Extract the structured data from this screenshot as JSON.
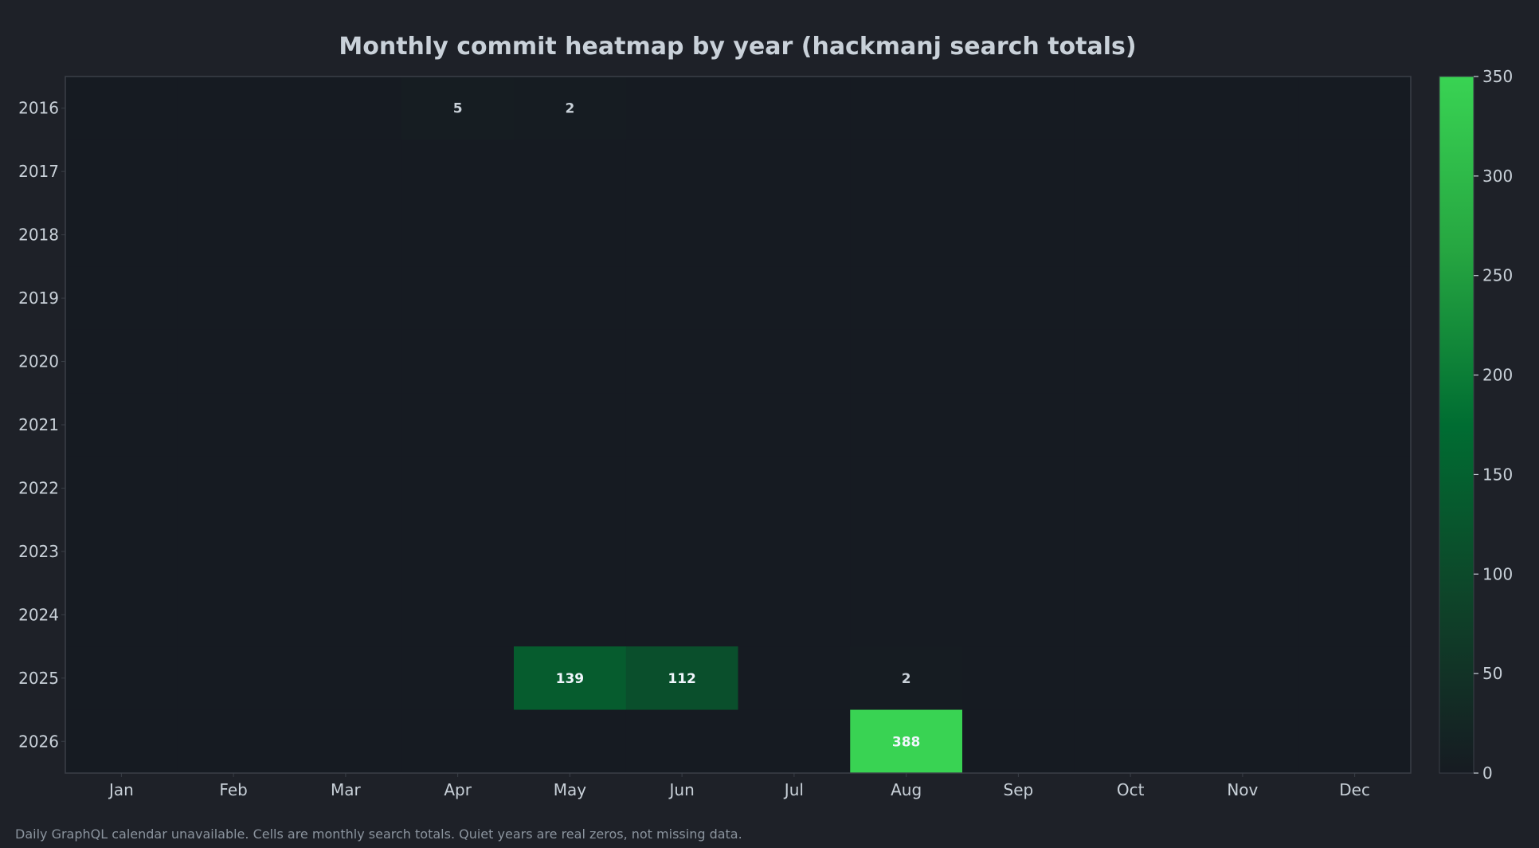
{
  "chart_data": {
    "type": "heatmap",
    "title": "Monthly commit heatmap by year (hackmanj search totals)",
    "x_categories": [
      "Jan",
      "Feb",
      "Mar",
      "Apr",
      "May",
      "Jun",
      "Jul",
      "Aug",
      "Sep",
      "Oct",
      "Nov",
      "Dec"
    ],
    "y_categories": [
      "2016",
      "2017",
      "2018",
      "2019",
      "2020",
      "2021",
      "2022",
      "2023",
      "2024",
      "2025",
      "2026"
    ],
    "values": [
      [
        0,
        0,
        0,
        5,
        2,
        0,
        0,
        0,
        0,
        0,
        0,
        0
      ],
      [
        0,
        0,
        0,
        0,
        0,
        0,
        0,
        0,
        0,
        0,
        0,
        0
      ],
      [
        0,
        0,
        0,
        0,
        0,
        0,
        0,
        0,
        0,
        0,
        0,
        0
      ],
      [
        0,
        0,
        0,
        0,
        0,
        0,
        0,
        0,
        0,
        0,
        0,
        0
      ],
      [
        0,
        0,
        0,
        0,
        0,
        0,
        0,
        0,
        0,
        0,
        0,
        0
      ],
      [
        0,
        0,
        0,
        0,
        0,
        0,
        0,
        0,
        0,
        0,
        0,
        0
      ],
      [
        0,
        0,
        0,
        0,
        0,
        0,
        0,
        0,
        0,
        0,
        0,
        0
      ],
      [
        0,
        0,
        0,
        0,
        0,
        0,
        0,
        0,
        0,
        0,
        0,
        0
      ],
      [
        0,
        0,
        0,
        0,
        0,
        0,
        0,
        0,
        0,
        0,
        0,
        0
      ],
      [
        0,
        0,
        0,
        0,
        139,
        112,
        0,
        2,
        0,
        0,
        0,
        0
      ],
      [
        0,
        0,
        0,
        0,
        0,
        0,
        0,
        388,
        0,
        0,
        0,
        0
      ]
    ],
    "colorbar": {
      "min": 0,
      "max": 350,
      "ticks": [
        0,
        50,
        100,
        150,
        200,
        250,
        300,
        350
      ],
      "colors": [
        "#161b22",
        "#0e4429",
        "#006d32",
        "#26a641",
        "#39d353"
      ]
    },
    "grid": false,
    "colorbar_position": "right"
  },
  "footnote": "Daily GraphQL calendar unavailable. Cells are monthly search totals. Quiet years are real zeros, not missing data.",
  "colors": {
    "background": "#1e2128",
    "plot_background": "#161b22",
    "text": "#c9d1d9",
    "muted_text": "#8b949e",
    "axis_border": "#3a3f47"
  }
}
